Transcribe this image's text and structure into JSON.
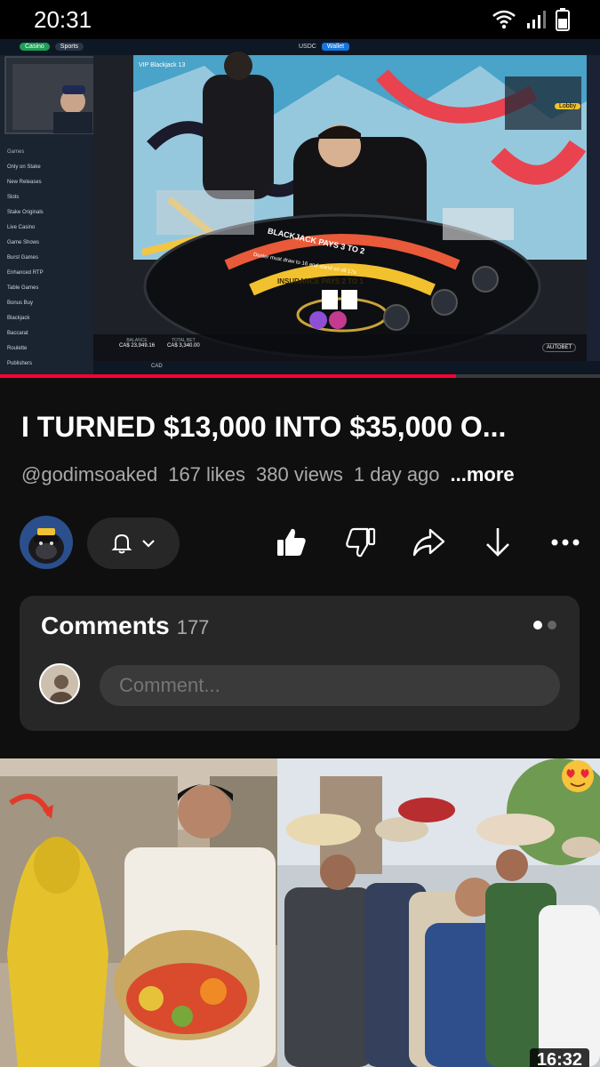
{
  "status_bar": {
    "time": "20:31",
    "icons": [
      "wifi-icon",
      "signal-icon",
      "battery-icon"
    ]
  },
  "video": {
    "site_tabs": [
      "Casino",
      "Sports"
    ],
    "wallet_label": "Wallet",
    "currency_label": "USDC",
    "table_title": "VIP Blackjack 13",
    "table_text_1": "BLACKJACK PAYS 3 TO 2",
    "table_text_2": "Dealer must draw to 16 and stand on all 17s",
    "insurance_text": "INSURANCE PAYS 2 TO 1",
    "balance_label": "BALANCE",
    "balance_value": "CA$ 23,949.16",
    "total_bet_label": "TOTAL BET",
    "total_bet_value": "CA$ 3,340.00",
    "autobet_label": "AUTOBET",
    "lobby_label": "Lobby",
    "sidebar_items": [
      "Games",
      "Only on Stake",
      "New Releases",
      "Slots",
      "Stake Originals",
      "Live Casino",
      "Game Shows",
      "Burst Games",
      "Enhanced RTP",
      "Table Games",
      "Bonus Buy",
      "Blackjack",
      "Baccarat",
      "Roulette",
      "Publishers"
    ],
    "currency_footer": "CAD",
    "progress": 0.76
  },
  "title": "I TURNED $13,000 INTO $35,000 O...",
  "meta": {
    "handle": "@godimsoaked",
    "likes": "167 likes",
    "views": "380 views",
    "age": "1 day ago",
    "more": "...more"
  },
  "actions": [
    "bell-icon",
    "chevron-down-icon",
    "like-icon",
    "dislike-icon",
    "share-icon",
    "download-icon",
    "more-icon"
  ],
  "comments": {
    "label": "Comments",
    "count": "177",
    "placeholder": "Comment..."
  },
  "next_video": {
    "duration": "16:32"
  },
  "colors": {
    "accent": "#ff0033",
    "background": "#0f0f0f",
    "card": "#272727"
  }
}
